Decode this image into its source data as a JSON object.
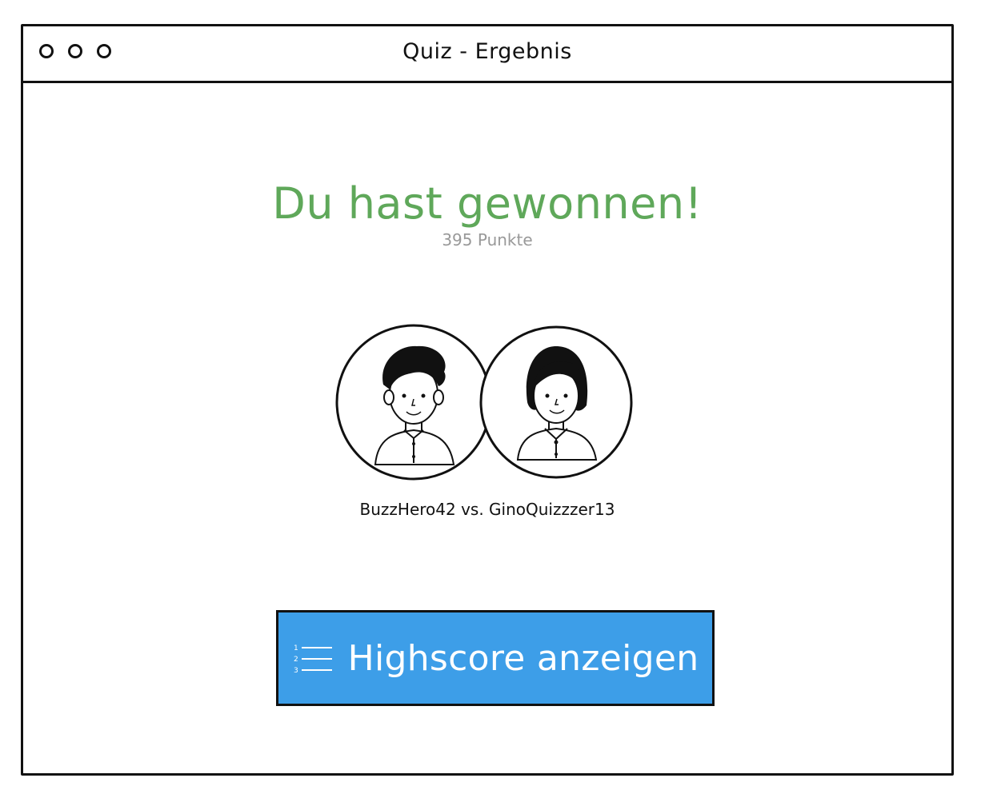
{
  "window": {
    "title": "Quiz - Ergebnis"
  },
  "result": {
    "headline": "Du hast gewonnen!",
    "points": "395 Punkte",
    "matchup": "BuzzHero42 vs. GinoQuizzzer13"
  },
  "players": [
    {
      "avatar_icon": "male-avatar-icon"
    },
    {
      "avatar_icon": "female-avatar-icon"
    }
  ],
  "cta": {
    "label": "Highscore anzeigen",
    "icon": "numbered-list-icon",
    "list_numbers": [
      "1",
      "2",
      "3"
    ]
  },
  "colors": {
    "headline": "#5fa85a",
    "button": "#3d9ee8",
    "muted": "#999999"
  }
}
